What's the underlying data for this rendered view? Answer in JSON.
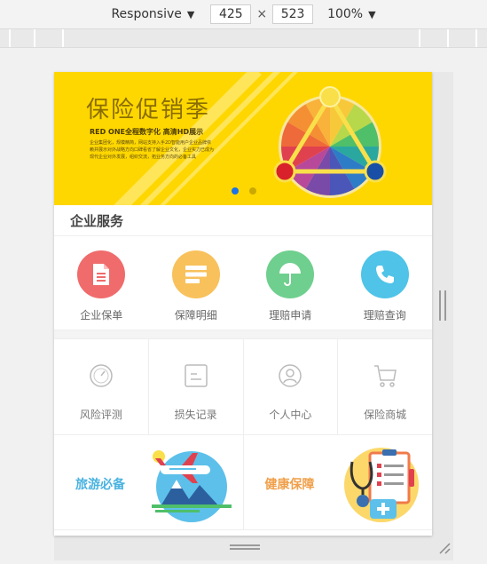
{
  "devtools": {
    "mode": "Responsive",
    "width": "425",
    "times": "×",
    "height": "523",
    "zoom": "100%"
  },
  "banner": {
    "title": "保险促销季",
    "subtitle": "RED ONE全程数字化 高清HD展示",
    "description": "企业集团化，规模精简，网站支持入手2D智能用户企业品牌依赖并展示对外战略方向口碑看省了解企业文化，企业实力已成为现代企业对外发展，组织交流，拓业务方向的必备工具",
    "carousel_active_color": "#1a73e8",
    "carousel_inactive_color": "#c9a800",
    "background_color": "#ffd700"
  },
  "section": {
    "title": "企业服务"
  },
  "services": [
    {
      "label": "企业保单",
      "icon": "document-icon",
      "color": "#f06b6b"
    },
    {
      "label": "保障明细",
      "icon": "list-icon",
      "color": "#f8c15c"
    },
    {
      "label": "理赔申请",
      "icon": "umbrella-icon",
      "color": "#6fcf8e"
    },
    {
      "label": "理赔查询",
      "icon": "phone-icon",
      "color": "#4fc3e8"
    }
  ],
  "tools": [
    {
      "label": "风险评测",
      "icon": "gauge-icon"
    },
    {
      "label": "损失记录",
      "icon": "note-icon"
    },
    {
      "label": "个人中心",
      "icon": "user-icon"
    },
    {
      "label": "保险商城",
      "icon": "cart-icon"
    }
  ],
  "promos": [
    {
      "label": "旅游必备",
      "color": "#4ab3e0",
      "art": "airplane-illustration-icon"
    },
    {
      "label": "健康保障",
      "color": "#f0a04b",
      "art": "health-kit-illustration-icon"
    }
  ]
}
